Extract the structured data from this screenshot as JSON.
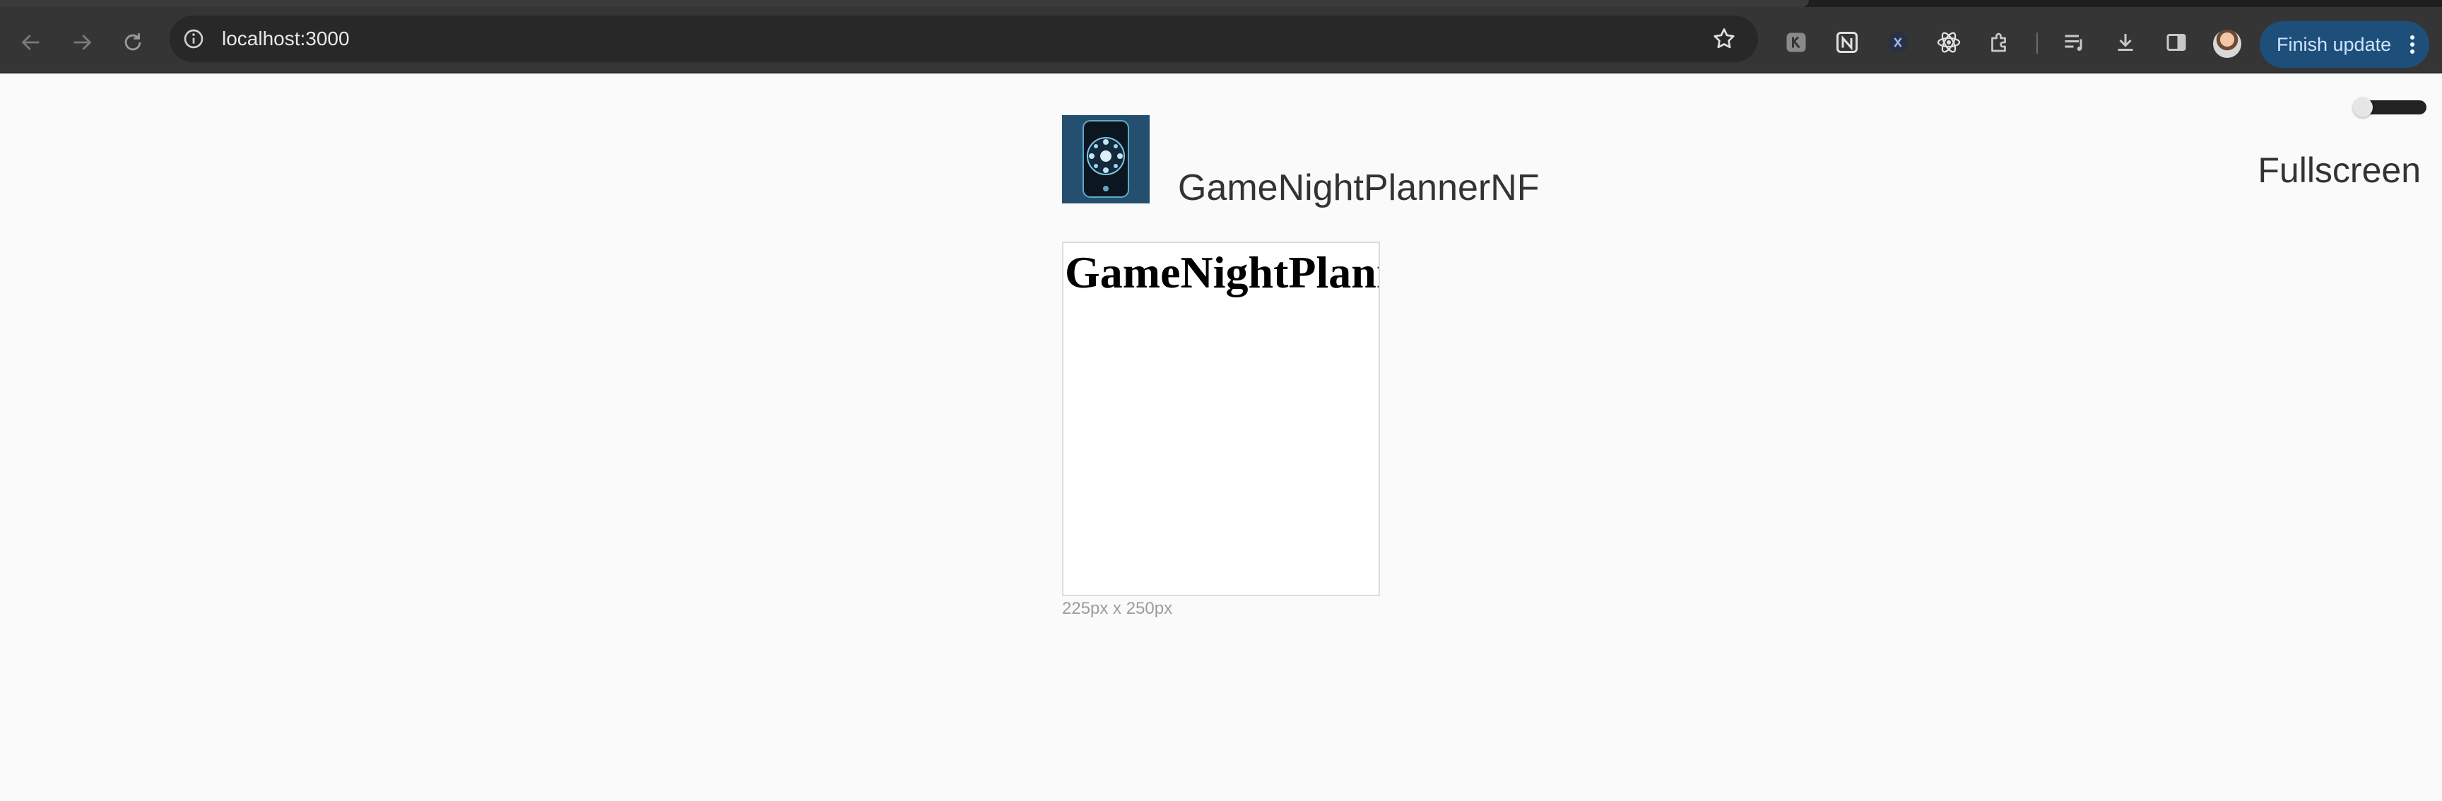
{
  "browser": {
    "address": "localhost:3000",
    "finish_update_label": "Finish update",
    "nav_icons": [
      "back-arrow-icon",
      "forward-arrow-icon",
      "reload-icon"
    ],
    "extension_icons": [
      "keyboard-extension-icon",
      "notion-icon",
      "x-extension-icon",
      "react-devtools-icon",
      "puzzle-extensions-icon",
      "reading-list-icon",
      "download-icon",
      "side-panel-icon"
    ],
    "accent_color": "#1d4f7a"
  },
  "page": {
    "app_title": "GameNightPlannerNF",
    "fullscreen_label": "Fullscreen",
    "preview_heading": "GameNightPlanner",
    "preview_dimensions": "225px x 250px",
    "fullscreen_toggle_on": false
  }
}
